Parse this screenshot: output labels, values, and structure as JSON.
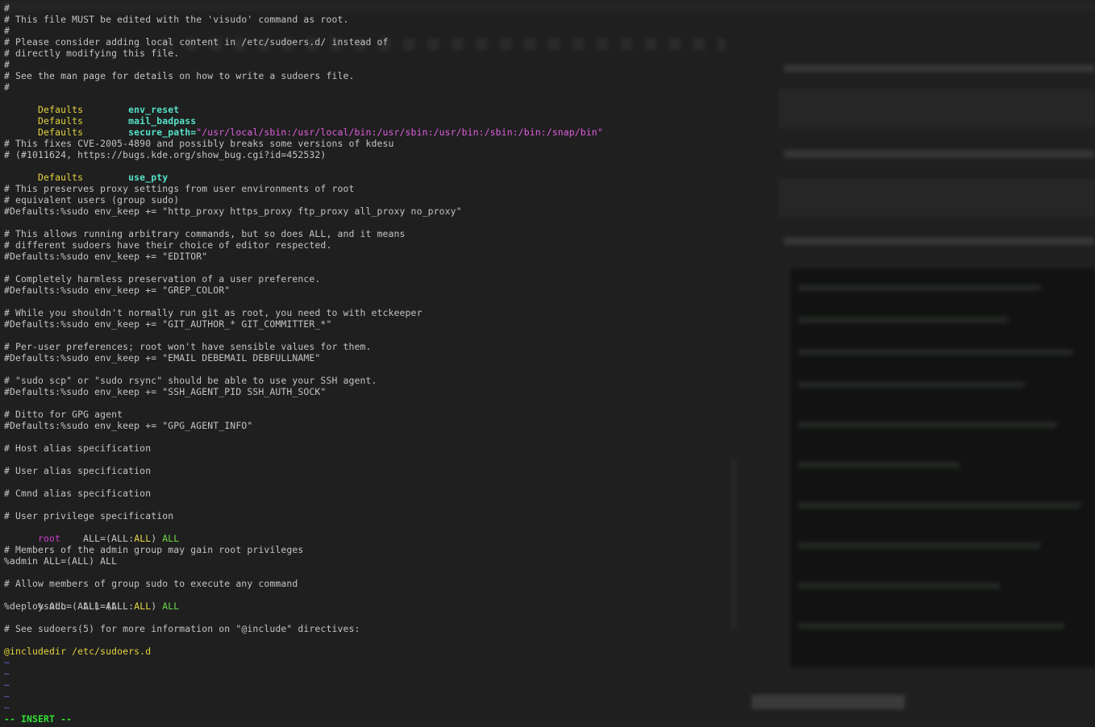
{
  "terminal": {
    "lines": [
      {
        "y": 17,
        "segs": [
          {
            "t": "#",
            "c": "c-comment"
          }
        ]
      },
      {
        "y": 17,
        "segs": []
      }
    ],
    "comments": {
      "c0": "#",
      "c1": "# This file MUST be edited with the 'visudo' command as root.",
      "c2": "#",
      "c3": "# Please consider adding local content in /etc/sudoers.d/ instead of",
      "c4": "# directly modifying this file.",
      "c5": "#",
      "c6": "# See the man page for details on how to write a sudoers file.",
      "c7": "#",
      "c8": "# This fixes CVE-2005-4890 and possibly breaks some versions of kdesu",
      "c9": "# (#1011624, https://bugs.kde.org/show_bug.cgi?id=452532)",
      "c10": "# This preserves proxy settings from user environments of root",
      "c11": "# equivalent users (group sudo)",
      "c12": "#Defaults:%sudo env_keep += \"http_proxy https_proxy ftp_proxy all_proxy no_proxy\"",
      "c13": "# This allows running arbitrary commands, but so does ALL, and it means",
      "c14": "# different sudoers have their choice of editor respected.",
      "c15": "#Defaults:%sudo env_keep += \"EDITOR\"",
      "c16": "# Completely harmless preservation of a user preference.",
      "c17": "#Defaults:%sudo env_keep += \"GREP_COLOR\"",
      "c18": "# While you shouldn't normally run git as root, you need to with etckeeper",
      "c19": "#Defaults:%sudo env_keep += \"GIT_AUTHOR_* GIT_COMMITTER_*\"",
      "c20": "# Per-user preferences; root won't have sensible values for them.",
      "c21": "#Defaults:%sudo env_keep += \"EMAIL DEBEMAIL DEBFULLNAME\"",
      "c22": "# \"sudo scp\" or \"sudo rsync\" should be able to use your SSH agent.",
      "c23": "#Defaults:%sudo env_keep += \"SSH_AGENT_PID SSH_AUTH_SOCK\"",
      "c24": "# Ditto for GPG agent",
      "c25": "#Defaults:%sudo env_keep += \"GPG_AGENT_INFO\"",
      "c26": "# Host alias specification",
      "c27": "# User alias specification",
      "c28": "# Cmnd alias specification",
      "c29": "# User privilege specification",
      "c30": "# Members of the admin group may gain root privileges",
      "c31": "# Allow members of group sudo to execute any command",
      "c32": "# See sudoers(5) for more information on \"@include\" directives:"
    },
    "defaults_kw": "Defaults",
    "env_reset": "env_reset",
    "mail_badpass": "mail_badpass",
    "secure_path_key": "secure_path=",
    "secure_path_val": "\"/usr/local/sbin:/usr/local/bin:/usr/sbin:/usr/bin:/sbin:/bin:/snap/bin\"",
    "use_pty": "use_pty",
    "root_user": "root",
    "root_rule_a": "ALL=(",
    "root_rule_b": "ALL",
    "root_rule_c": ":",
    "root_rule_d": "ALL",
    "root_rule_e": ") ",
    "root_rule_f": "ALL",
    "admin_rule": "%admin ALL=(ALL) ALL",
    "sudo_user": "%sudo",
    "deploy_rule": "%deploy ALL=(ALL) ALL",
    "includedir": "@includedir /etc/sudoers.d",
    "tilde": "~",
    "mode": "-- INSERT --"
  }
}
